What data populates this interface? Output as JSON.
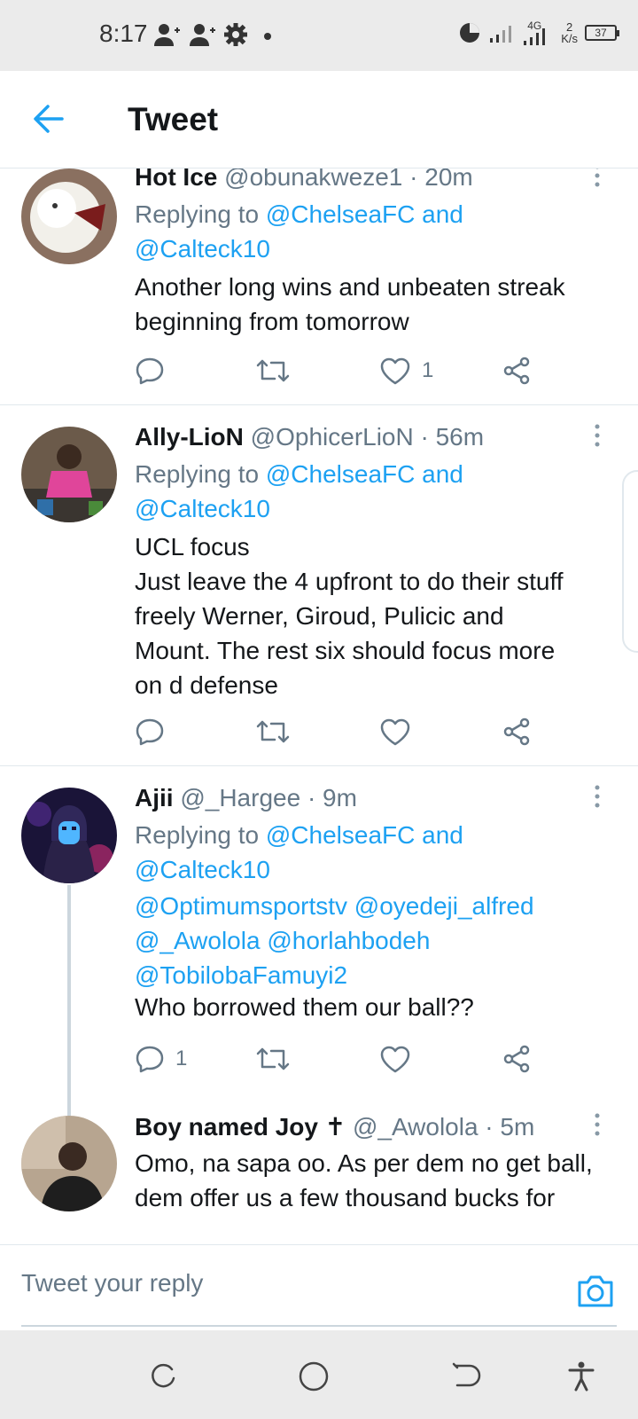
{
  "status_bar": {
    "time": "8:17",
    "network": "4G",
    "speed_value": "2",
    "speed_unit": "K/s",
    "battery": "37"
  },
  "header": {
    "title": "Tweet"
  },
  "tweets": [
    {
      "name": "Hot Ice",
      "handle": "@obunakweze1 · 20m",
      "reply_prefix": "Replying to",
      "reply_targets_line1": "@ChelseaFC and",
      "reply_targets_line2": "@Calteck10",
      "text": "Another long wins and unbeaten streak\nbeginning from tomorrow",
      "likes": "1"
    },
    {
      "name": "Ally-LioN",
      "handle": "@OphicerLioN · 56m",
      "reply_prefix": "Replying to",
      "reply_targets_line1": "@ChelseaFC and",
      "reply_targets_line2": "@Calteck10",
      "text": "UCL focus\nJust leave the 4 upfront to do their stuff\nfreely    Werner, Giroud, Pulicic and\nMount.   The rest six should focus more\non d defense"
    },
    {
      "name": "Ajii",
      "handle": "@_Hargee · 9m",
      "reply_prefix": "Replying to",
      "reply_targets_line1": "@ChelseaFC and",
      "reply_targets_line2": "@Calteck10",
      "mentions": "@Optimumsportstv @oyedeji_alfred\n@_Awolola @horlahbodeh\n@TobilobaFamuyi2",
      "text": "Who borrowed them our ball??",
      "replies": "1"
    },
    {
      "name": "Boy named Joy ✝",
      "handle": "@_Awolola · 5m",
      "text": "Omo, na sapa oo. As per dem no get ball,\ndem offer us a few thousand bucks for"
    }
  ],
  "reply_bar": {
    "placeholder": "Tweet your reply"
  },
  "colors": {
    "accent": "#1da1f2",
    "secondary_text": "#657786",
    "divider": "#e1e8ed"
  }
}
